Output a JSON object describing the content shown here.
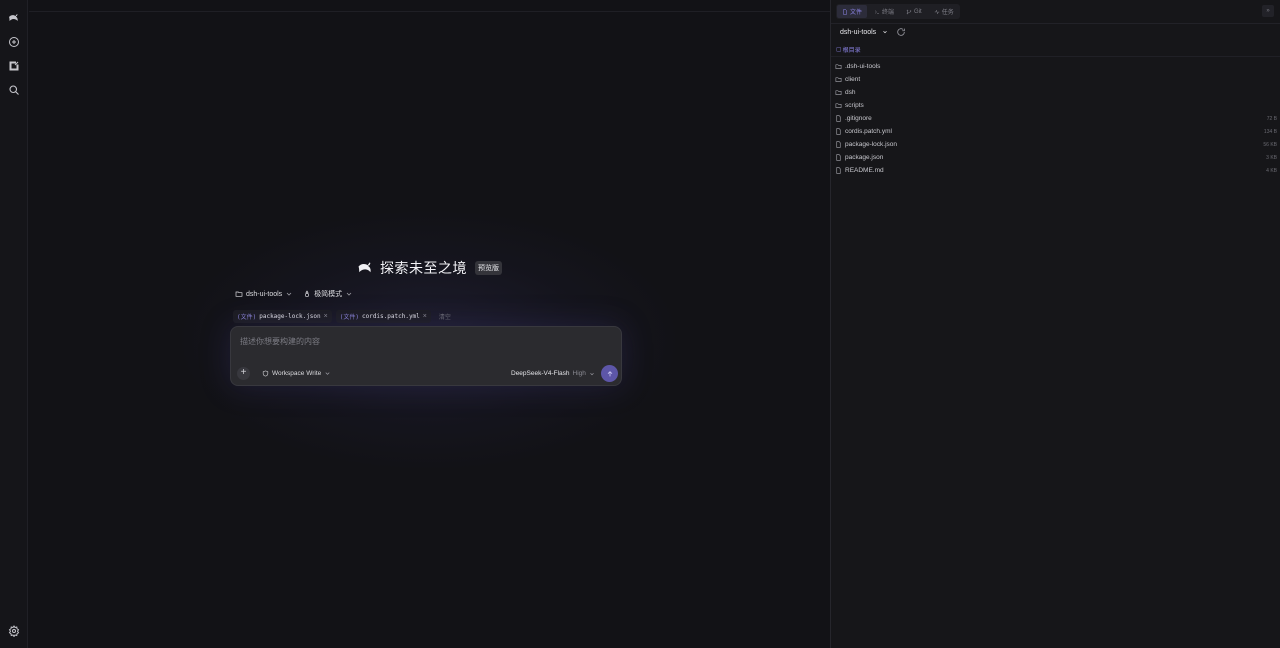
{
  "rail": {
    "items": [
      {
        "name": "logo-icon"
      },
      {
        "name": "new-chat-icon"
      },
      {
        "name": "compose-icon"
      },
      {
        "name": "search-icon"
      }
    ],
    "bottom": {
      "name": "settings-icon"
    }
  },
  "hero": {
    "title": "探索未至之境",
    "badge": "预览版"
  },
  "context": {
    "project": "dsh-ui-tools",
    "mode": "极简模式"
  },
  "attachments": {
    "items": [
      {
        "tag": "(文件)",
        "name": "package-lock.json"
      },
      {
        "tag": "(文件)",
        "name": "cordis.patch.yml"
      }
    ],
    "clear_label": "清空"
  },
  "composer": {
    "placeholder": "描述你想要构建的内容",
    "permission": "Workspace Write",
    "model": "DeepSeek-V4-Flash",
    "effort": "High"
  },
  "panel": {
    "tabs": [
      {
        "label": "文件",
        "active": true,
        "icon": "file-icon"
      },
      {
        "label": "终端",
        "active": false,
        "icon": "terminal-icon"
      },
      {
        "label": "Git",
        "active": false,
        "icon": "git-icon"
      },
      {
        "label": "任务",
        "active": false,
        "icon": "task-icon"
      }
    ],
    "more_label": "»",
    "repo": "dsh-ui-tools",
    "root_label": "根目录",
    "files": [
      {
        "name": ".dsh-ui-tools",
        "type": "folder",
        "size": ""
      },
      {
        "name": "client",
        "type": "folder",
        "size": ""
      },
      {
        "name": "dsh",
        "type": "folder",
        "size": ""
      },
      {
        "name": "scripts",
        "type": "folder",
        "size": ""
      },
      {
        "name": ".gitignore",
        "type": "file",
        "size": "72 B"
      },
      {
        "name": "cordis.patch.yml",
        "type": "file",
        "size": "134 B"
      },
      {
        "name": "package-lock.json",
        "type": "file",
        "size": "56 KB"
      },
      {
        "name": "package.json",
        "type": "file",
        "size": "3 KB"
      },
      {
        "name": "README.md",
        "type": "file",
        "size": "4 KB"
      }
    ]
  },
  "colors": {
    "accent": "#8c84e6",
    "send": "#5d56a8",
    "background": "#121216"
  }
}
